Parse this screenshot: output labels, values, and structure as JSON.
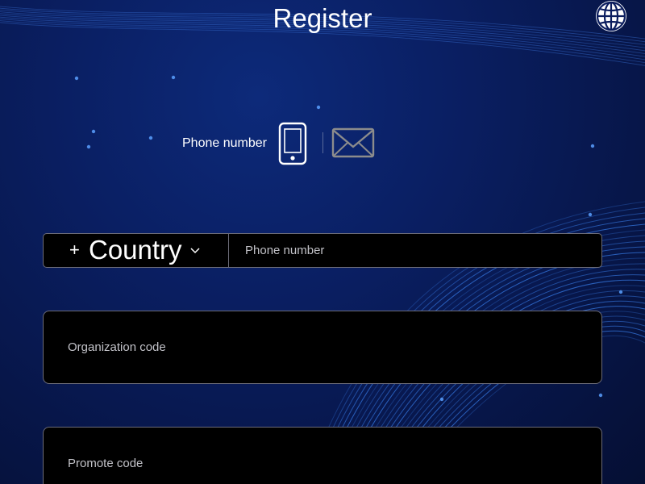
{
  "header": {
    "title": "Register",
    "language_icon": "globe-icon"
  },
  "method": {
    "label": "Phone number",
    "phone_icon": "smartphone-icon",
    "email_icon": "envelope-icon"
  },
  "form": {
    "country": {
      "prefix": "+",
      "label": "Country",
      "chevron_icon": "chevron-down-icon"
    },
    "phone": {
      "placeholder": "Phone number",
      "value": ""
    },
    "organization_code": {
      "placeholder": "Organization code",
      "value": ""
    },
    "promote_code": {
      "placeholder": "Promote code",
      "value": ""
    }
  },
  "colors": {
    "background": "#0a1f63",
    "field_background": "#000000",
    "field_border": "#6c6c78",
    "text": "#ffffff",
    "placeholder": "#c2c2c8",
    "accent_lines": "#3f8cff"
  }
}
